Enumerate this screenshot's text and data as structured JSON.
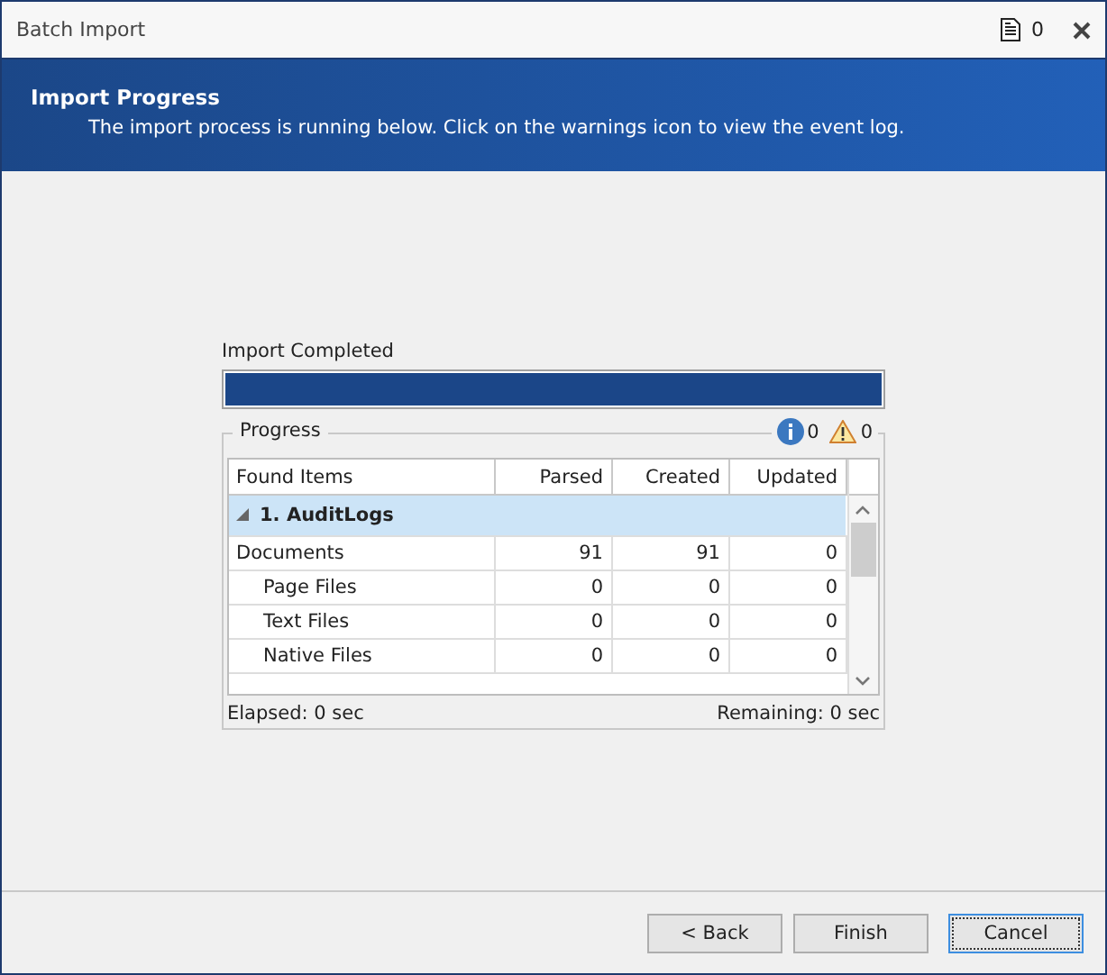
{
  "window": {
    "title": "Batch Import",
    "log_count": "0"
  },
  "header": {
    "title": "Import Progress",
    "subtitle": "The import process is running below. Click on the warnings icon to view the event log."
  },
  "status": {
    "label": "Import Completed",
    "level": 1
  },
  "progress_group": {
    "title": "Progress",
    "info_count": "0",
    "warning_count": "0"
  },
  "table": {
    "columns": [
      "Found Items",
      "Parsed",
      "Created",
      "Updated"
    ],
    "groups": [
      {
        "name": "1. AuditLogs",
        "expanded": true,
        "rows": [
          {
            "kind": "parent",
            "cells": [
              "Documents",
              "91",
              "91",
              "0"
            ]
          },
          {
            "kind": "child",
            "cells": [
              "Page Files",
              "0",
              "0",
              "0"
            ]
          },
          {
            "kind": "child",
            "cells": [
              "Text Files",
              "0",
              "0",
              "0"
            ]
          },
          {
            "kind": "child",
            "cells": [
              "Native Files",
              "0",
              "0",
              "0"
            ]
          }
        ]
      }
    ]
  },
  "elapsed": "Elapsed: 0 sec",
  "remaining": "Remaining: 0 sec",
  "buttons": [
    {
      "label": "< Back",
      "focused": false
    },
    {
      "label": "Finish",
      "focused": false
    },
    {
      "label": "Cancel",
      "focused": true
    }
  ]
}
